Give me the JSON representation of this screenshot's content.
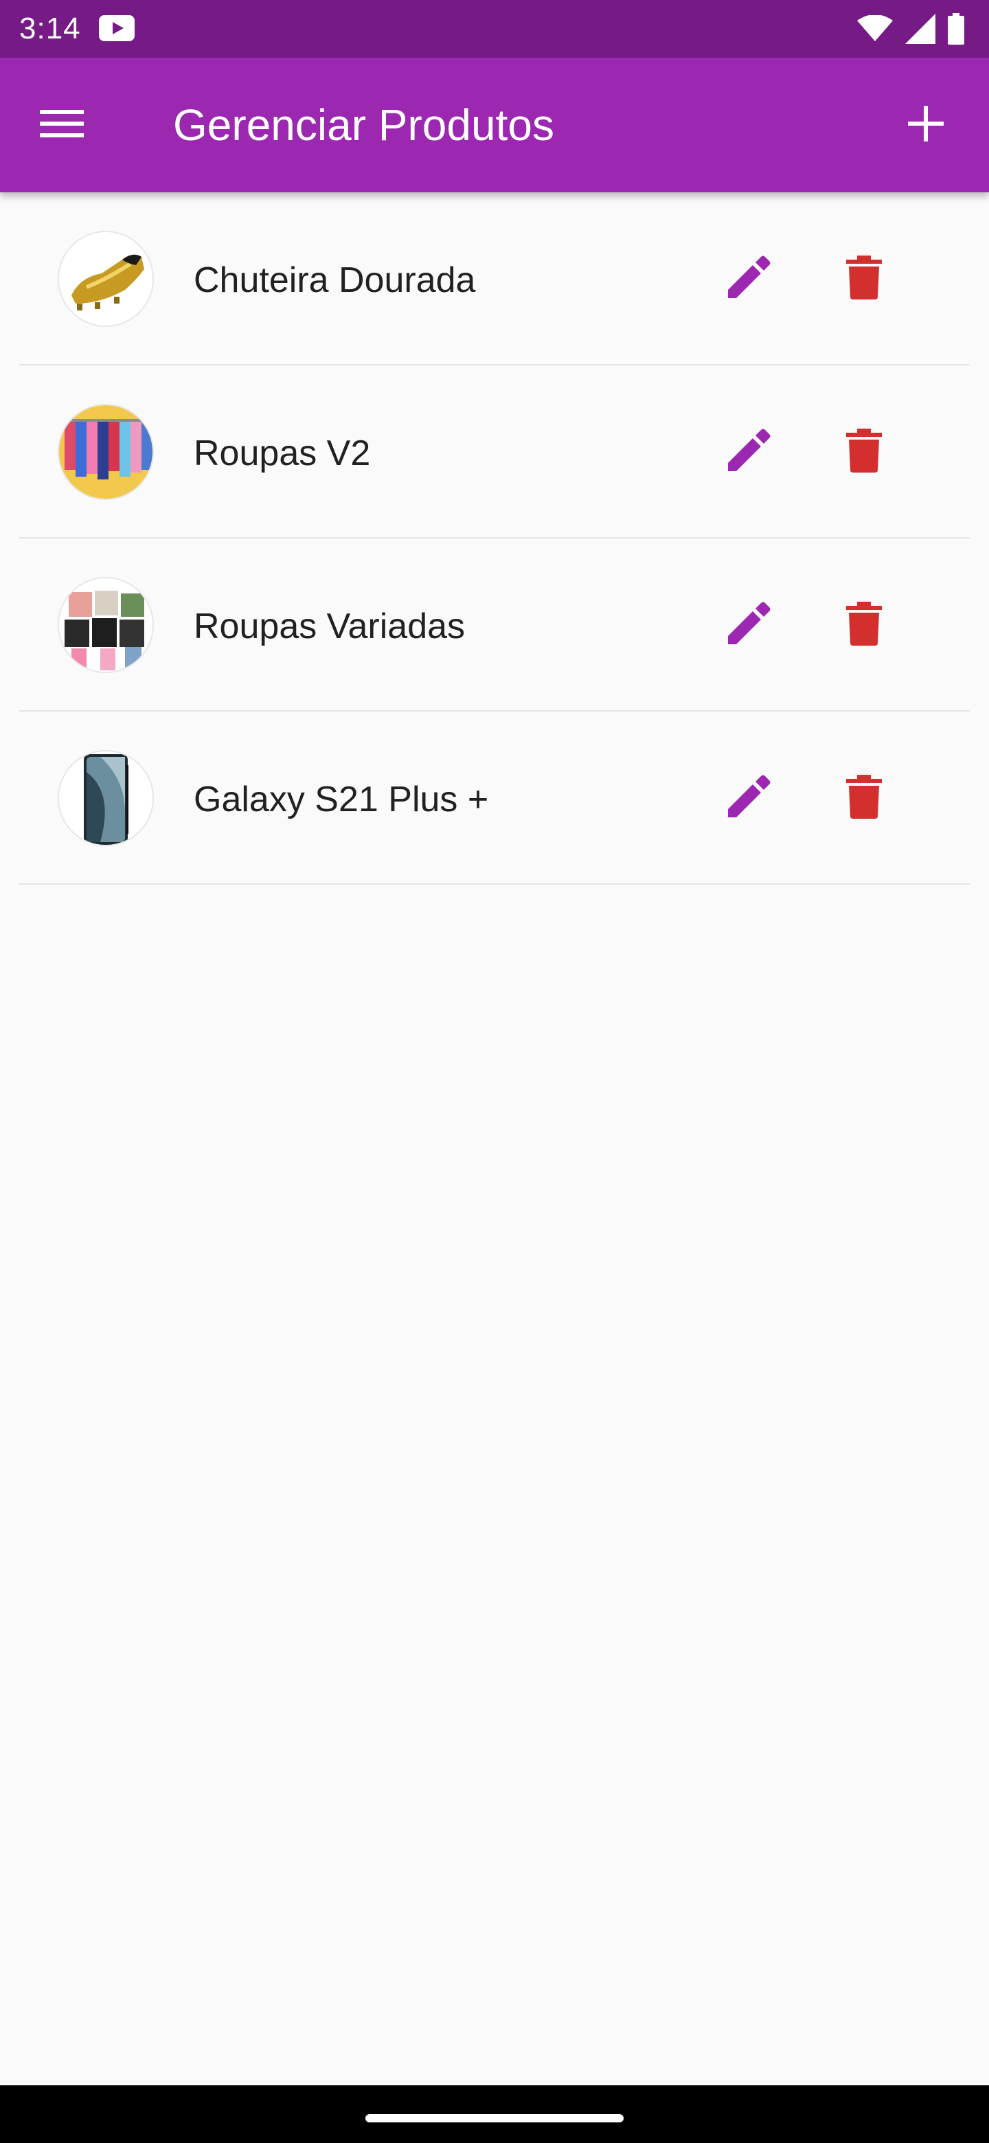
{
  "status_bar": {
    "time": "3:14",
    "icons": [
      "youtube-play-icon",
      "wifi-icon",
      "signal-icon",
      "battery-icon"
    ]
  },
  "app_bar": {
    "title": "Gerenciar Produtos",
    "menu_icon": "hamburger-menu-icon",
    "add_icon": "plus-icon",
    "background": "#9C27B0"
  },
  "products": [
    {
      "name": "Chuteira Dourada"
    },
    {
      "name": "Roupas V2"
    },
    {
      "name": "Roupas Variadas"
    },
    {
      "name": "Galaxy S21 Plus +"
    }
  ],
  "colors": {
    "status_bar": "#761B86",
    "accent": "#9C27B0",
    "delete": "#D32F2F",
    "edit": "#9C27B0"
  }
}
